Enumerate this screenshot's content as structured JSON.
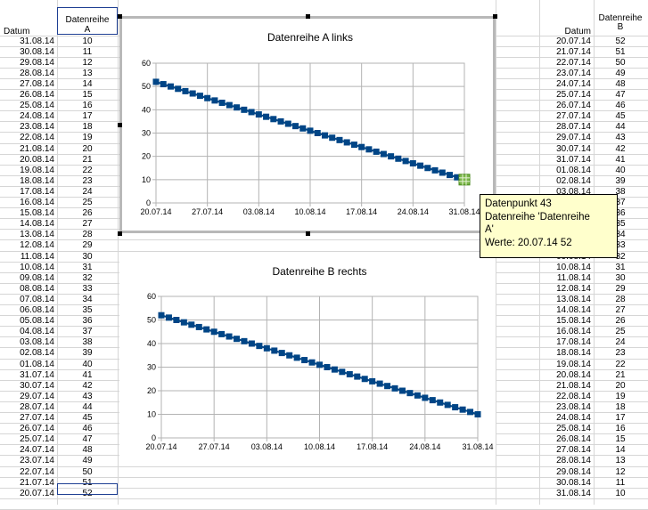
{
  "sheet": {
    "left_header_date": "Datum",
    "left_header_series": "Datenreihe A",
    "left_header_series_line1": "Datenreihe",
    "left_header_series_line2": "A",
    "right_header_date": "Datum",
    "right_header_series_line1": "Datenreihe",
    "right_header_series_line2": "B",
    "left_rows": [
      [
        "31.08.14",
        "10"
      ],
      [
        "30.08.14",
        "11"
      ],
      [
        "29.08.14",
        "12"
      ],
      [
        "28.08.14",
        "13"
      ],
      [
        "27.08.14",
        "14"
      ],
      [
        "26.08.14",
        "15"
      ],
      [
        "25.08.14",
        "16"
      ],
      [
        "24.08.14",
        "17"
      ],
      [
        "23.08.14",
        "18"
      ],
      [
        "22.08.14",
        "19"
      ],
      [
        "21.08.14",
        "20"
      ],
      [
        "20.08.14",
        "21"
      ],
      [
        "19.08.14",
        "22"
      ],
      [
        "18.08.14",
        "23"
      ],
      [
        "17.08.14",
        "24"
      ],
      [
        "16.08.14",
        "25"
      ],
      [
        "15.08.14",
        "26"
      ],
      [
        "14.08.14",
        "27"
      ],
      [
        "13.08.14",
        "28"
      ],
      [
        "12.08.14",
        "29"
      ],
      [
        "11.08.14",
        "30"
      ],
      [
        "10.08.14",
        "31"
      ],
      [
        "09.08.14",
        "32"
      ],
      [
        "08.08.14",
        "33"
      ],
      [
        "07.08.14",
        "34"
      ],
      [
        "06.08.14",
        "35"
      ],
      [
        "05.08.14",
        "36"
      ],
      [
        "04.08.14",
        "37"
      ],
      [
        "03.08.14",
        "38"
      ],
      [
        "02.08.14",
        "39"
      ],
      [
        "01.08.14",
        "40"
      ],
      [
        "31.07.14",
        "41"
      ],
      [
        "30.07.14",
        "42"
      ],
      [
        "29.07.14",
        "43"
      ],
      [
        "28.07.14",
        "44"
      ],
      [
        "27.07.14",
        "45"
      ],
      [
        "26.07.14",
        "46"
      ],
      [
        "25.07.14",
        "47"
      ],
      [
        "24.07.14",
        "48"
      ],
      [
        "23.07.14",
        "49"
      ],
      [
        "22.07.14",
        "50"
      ],
      [
        "21.07.14",
        "51"
      ],
      [
        "20.07.14",
        "52"
      ]
    ],
    "right_rows": [
      [
        "20.07.14",
        "52"
      ],
      [
        "21.07.14",
        "51"
      ],
      [
        "22.07.14",
        "50"
      ],
      [
        "23.07.14",
        "49"
      ],
      [
        "24.07.14",
        "48"
      ],
      [
        "25.07.14",
        "47"
      ],
      [
        "26.07.14",
        "46"
      ],
      [
        "27.07.14",
        "45"
      ],
      [
        "28.07.14",
        "44"
      ],
      [
        "29.07.14",
        "43"
      ],
      [
        "30.07.14",
        "42"
      ],
      [
        "31.07.14",
        "41"
      ],
      [
        "01.08.14",
        "40"
      ],
      [
        "02.08.14",
        "39"
      ],
      [
        "03.08.14",
        "38"
      ],
      [
        "04.08.14",
        "37"
      ],
      [
        "05.08.14",
        "36"
      ],
      [
        "06.08.14",
        "35"
      ],
      [
        "07.08.14",
        "34"
      ],
      [
        "08.08.14",
        "33"
      ],
      [
        "09.08.14",
        "32"
      ],
      [
        "10.08.14",
        "31"
      ],
      [
        "11.08.14",
        "30"
      ],
      [
        "12.08.14",
        "29"
      ],
      [
        "13.08.14",
        "28"
      ],
      [
        "14.08.14",
        "27"
      ],
      [
        "15.08.14",
        "26"
      ],
      [
        "16.08.14",
        "25"
      ],
      [
        "17.08.14",
        "24"
      ],
      [
        "18.08.14",
        "23"
      ],
      [
        "19.08.14",
        "22"
      ],
      [
        "20.08.14",
        "21"
      ],
      [
        "21.08.14",
        "20"
      ],
      [
        "22.08.14",
        "19"
      ],
      [
        "23.08.14",
        "18"
      ],
      [
        "24.08.14",
        "17"
      ],
      [
        "25.08.14",
        "16"
      ],
      [
        "26.08.14",
        "15"
      ],
      [
        "27.08.14",
        "14"
      ],
      [
        "28.08.14",
        "13"
      ],
      [
        "29.08.14",
        "12"
      ],
      [
        "30.08.14",
        "11"
      ],
      [
        "31.08.14",
        "10"
      ]
    ]
  },
  "tooltip": {
    "line1": "Datenpunkt 43",
    "line2": "Datenreihe 'Datenreihe",
    "line3": "A'",
    "line4": "Werte: 20.07.14 52"
  },
  "chart_data": [
    {
      "type": "line",
      "title": "Datenreihe A links",
      "x_tick_labels": [
        "20.07.14",
        "27.07.14",
        "03.08.14",
        "10.08.14",
        "17.08.14",
        "24.08.14",
        "31.08.14"
      ],
      "y_tick_labels": [
        "0",
        "10",
        "20",
        "30",
        "40",
        "50",
        "60"
      ],
      "ylim": [
        0,
        60
      ],
      "x_start": "20.07.14",
      "x_end": "31.08.14",
      "values": [
        52,
        51,
        50,
        49,
        48,
        47,
        46,
        45,
        44,
        43,
        42,
        41,
        40,
        39,
        38,
        37,
        36,
        35,
        34,
        33,
        32,
        31,
        30,
        29,
        28,
        27,
        26,
        25,
        24,
        23,
        22,
        21,
        20,
        19,
        18,
        17,
        16,
        15,
        14,
        13,
        12,
        11,
        10
      ],
      "grid": true,
      "legend": "none",
      "color": "#004586"
    },
    {
      "type": "line",
      "title": "Datenreihe B rechts",
      "x_tick_labels": [
        "20.07.14",
        "27.07.14",
        "03.08.14",
        "10.08.14",
        "17.08.14",
        "24.08.14",
        "31.08.14"
      ],
      "y_tick_labels": [
        "0",
        "10",
        "20",
        "30",
        "40",
        "50",
        "60"
      ],
      "ylim": [
        0,
        60
      ],
      "x_start": "20.07.14",
      "x_end": "31.08.14",
      "values": [
        52,
        51,
        50,
        49,
        48,
        47,
        46,
        45,
        44,
        43,
        42,
        41,
        40,
        39,
        38,
        37,
        36,
        35,
        34,
        33,
        32,
        31,
        30,
        29,
        28,
        27,
        26,
        25,
        24,
        23,
        22,
        21,
        20,
        19,
        18,
        17,
        16,
        15,
        14,
        13,
        12,
        11,
        10
      ],
      "grid": true,
      "legend": "none",
      "color": "#004586"
    }
  ]
}
